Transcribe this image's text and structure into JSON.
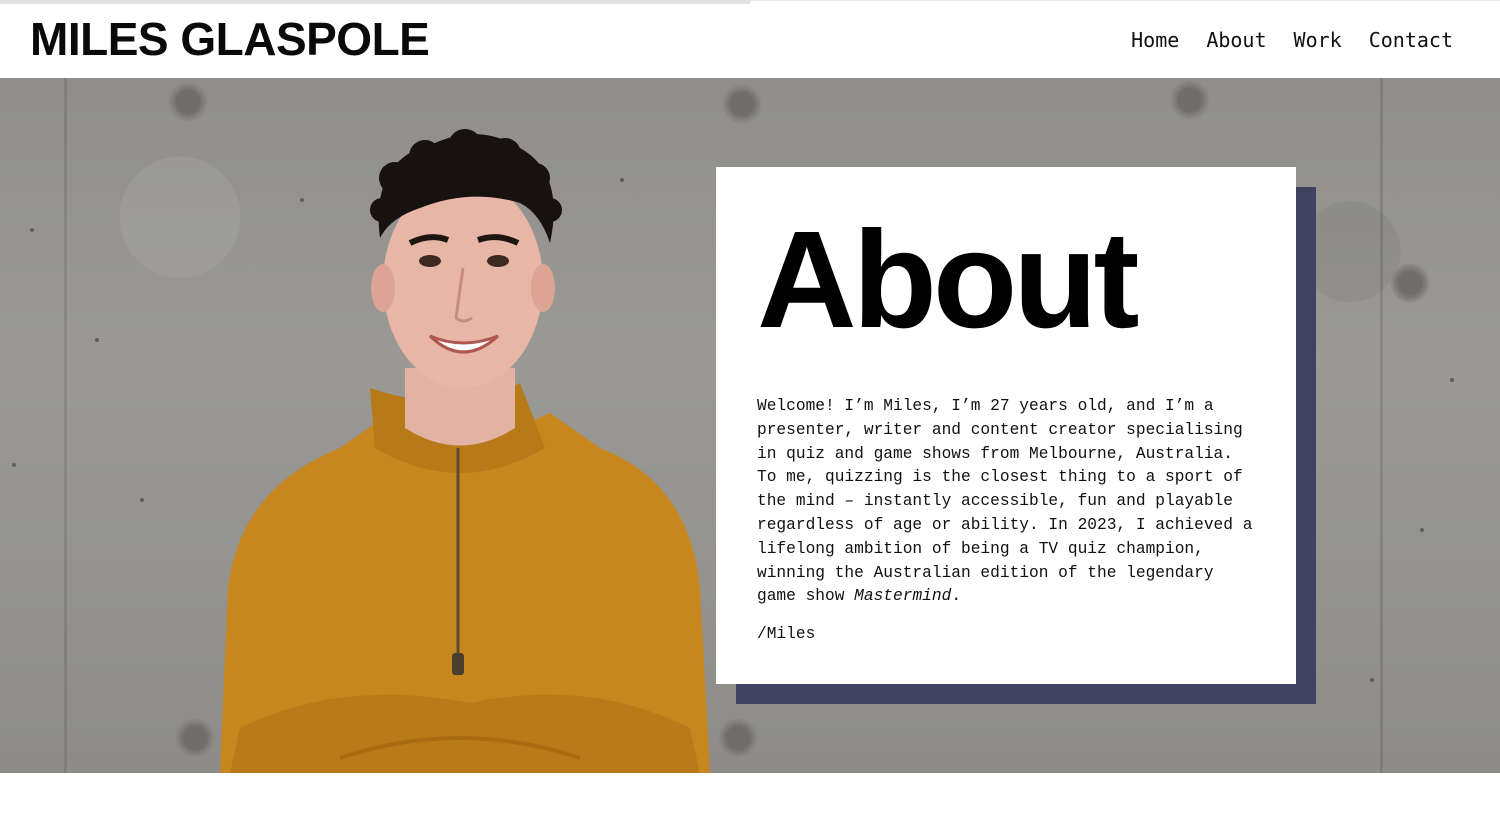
{
  "site": {
    "title": "MILES GLASPOLE"
  },
  "nav": {
    "items": [
      "Home",
      "About",
      "Work",
      "Contact"
    ]
  },
  "about": {
    "heading": "About",
    "intro": "Welcome! I’m Miles, I’m 27 years old, and I’m a presenter, writer and content creator specialising in quiz and game shows from Melbourne, Australia. To me, quizzing is the closest thing to a sport of the mind – instantly accessible, fun and playable regardless of age or ability. In 2023, I achieved a lifelong ambition of being a TV quiz champion, winning the Australian edition of the legendary game show ",
    "show_name": "Mastermind",
    "intro_end": ".",
    "signoff": "/Miles"
  },
  "colors": {
    "card_shadow": "#414262",
    "sweater": "#c8861e",
    "wall": "#93928e"
  }
}
